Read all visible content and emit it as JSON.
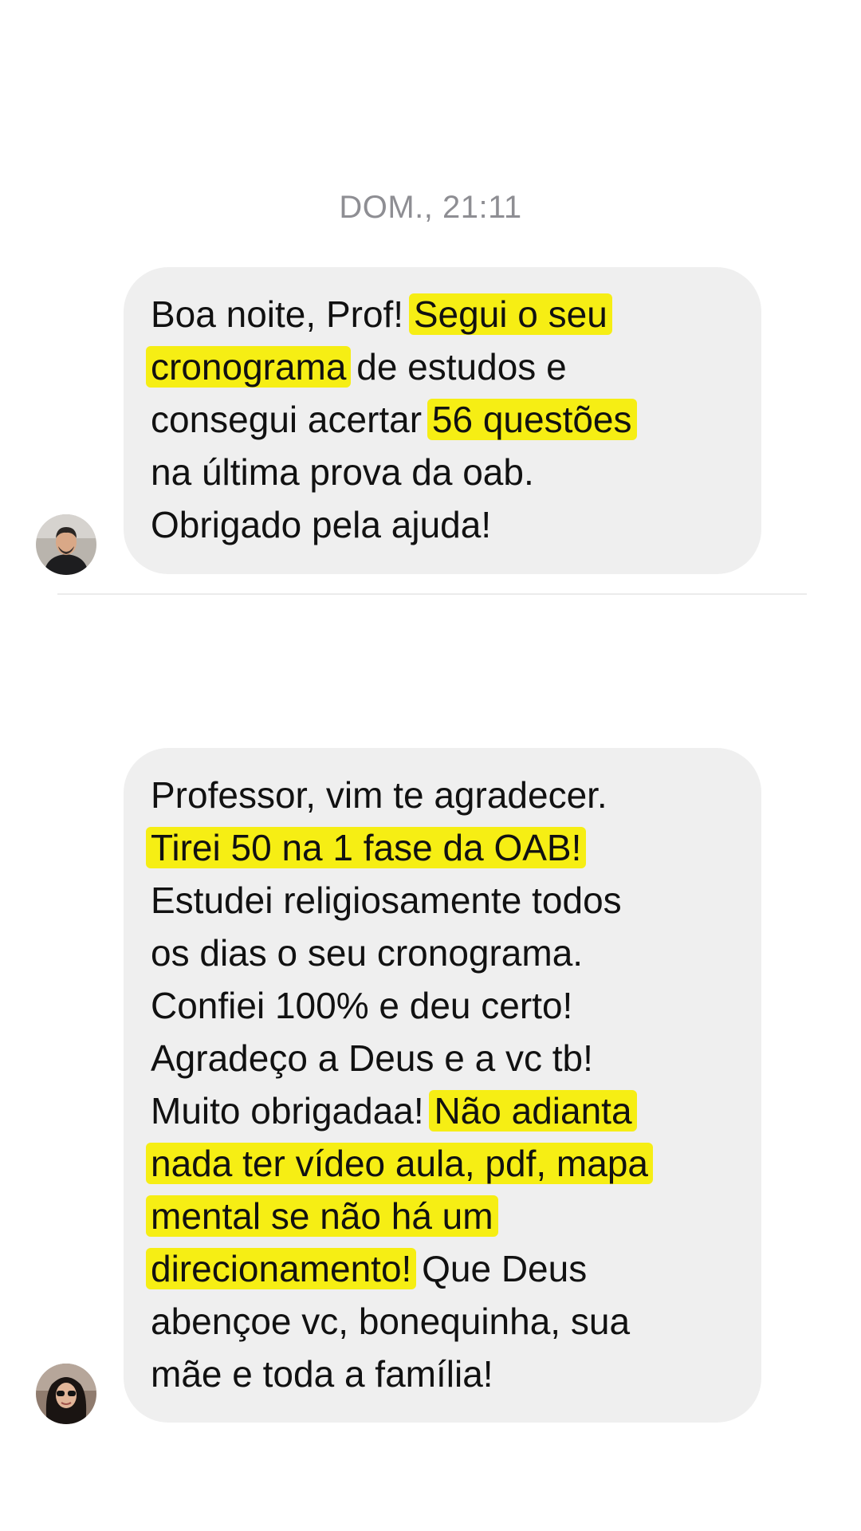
{
  "thread": {
    "timestamp": "DOM., 21:11",
    "highlight_color": "#f6ee14",
    "bubble_color": "#efefef"
  },
  "messages": [
    {
      "avatar_icon": "man-avatar-icon",
      "lines": [
        [
          {
            "t": "Boa noite, Prof! ",
            "h": false
          },
          {
            "t": "Segui o seu",
            "h": true
          }
        ],
        [
          {
            "t": "cronograma",
            "h": true
          },
          {
            "t": " de estudos e",
            "h": false
          }
        ],
        [
          {
            "t": "consegui acertar ",
            "h": false
          },
          {
            "t": "56 questões",
            "h": true
          }
        ],
        [
          {
            "t": "na última prova da oab.",
            "h": false
          }
        ],
        [
          {
            "t": "Obrigado pela ajuda!",
            "h": false
          }
        ]
      ]
    },
    {
      "avatar_icon": "woman-avatar-icon",
      "lines": [
        [
          {
            "t": "Professor, vim te agradecer.",
            "h": false
          }
        ],
        [
          {
            "t": "Tirei 50 na  1 fase da OAB!",
            "h": true
          }
        ],
        [
          {
            "t": "Estudei religiosamente todos",
            "h": false
          }
        ],
        [
          {
            "t": "os dias o seu cronograma.",
            "h": false
          }
        ],
        [
          {
            "t": "Confiei 100% e deu certo!",
            "h": false
          }
        ],
        [
          {
            "t": "Agradeço a Deus e a vc tb!",
            "h": false
          }
        ],
        [
          {
            "t": "Muito obrigadaa! ",
            "h": false
          },
          {
            "t": "Não adianta",
            "h": true
          }
        ],
        [
          {
            "t": "nada ter vídeo aula, pdf, mapa",
            "h": true
          }
        ],
        [
          {
            "t": "mental se não há um",
            "h": true
          }
        ],
        [
          {
            "t": "direcionamento!",
            "h": true
          },
          {
            "t": " Que Deus",
            "h": false
          }
        ],
        [
          {
            "t": "abençoe vc, bonequinha, sua",
            "h": false
          }
        ],
        [
          {
            "t": "mãe e toda a família!",
            "h": false
          }
        ]
      ]
    }
  ]
}
